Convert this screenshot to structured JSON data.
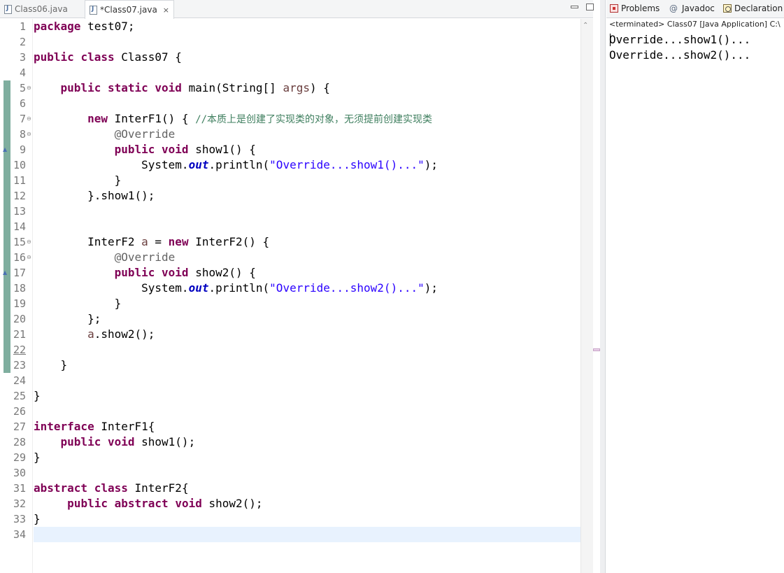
{
  "editor": {
    "tabs": [
      {
        "label": "Class06.java",
        "active": false
      },
      {
        "label": "*Class07.java",
        "active": true,
        "close": "×"
      }
    ],
    "line_numbers": [
      "1",
      "2",
      "3",
      "4",
      "5",
      "6",
      "7",
      "8",
      "9",
      "10",
      "11",
      "12",
      "13",
      "14",
      "15",
      "16",
      "17",
      "18",
      "19",
      "20",
      "21",
      "22",
      "23",
      "24",
      "25",
      "26",
      "27",
      "28",
      "29",
      "30",
      "31",
      "32",
      "33",
      "34"
    ],
    "current_line": "22",
    "fold_markers": [
      "⊖",
      "⊖",
      "⊖",
      "⊖",
      "⊖"
    ],
    "code": {
      "l1": {
        "kw": "package",
        "rest": " test07;"
      },
      "l3": {
        "kw1": "public",
        "kw2": "class",
        "rest": " Class07 {"
      },
      "l5": {
        "indent": "    ",
        "kw1": "public",
        "kw2": "static",
        "kw3": "void",
        "p1": " main(String[] ",
        "var": "args",
        "p2": ") {"
      },
      "l7": {
        "indent": "        ",
        "kw": "new",
        "p1": " InterF1() { ",
        "comment": "//本质上是创建了实现类的对象，无须提前创建实现类"
      },
      "l8": {
        "indent": "            ",
        "ann": "@Override"
      },
      "l9": {
        "indent": "            ",
        "kw1": "public",
        "kw2": "void",
        "rest": " show1() {"
      },
      "l10": {
        "indent": "                ",
        "p1": "System.",
        "fld": "out",
        "p2": ".println(",
        "str": "\"Override...show1()...\"",
        "p3": ");"
      },
      "l11": {
        "text": "            }"
      },
      "l12": {
        "text": "        }.show1();"
      },
      "l15": {
        "indent": "        ",
        "p1": "InterF2 ",
        "var": "a",
        "p2": " = ",
        "kw": "new",
        "p3": " InterF2() {"
      },
      "l16": {
        "indent": "            ",
        "ann": "@Override"
      },
      "l17": {
        "indent": "            ",
        "kw1": "public",
        "kw2": "void",
        "rest": " show2() {"
      },
      "l18": {
        "indent": "                ",
        "p1": "System.",
        "fld": "out",
        "p2": ".println(",
        "str": "\"Override...show2()...\"",
        "p3": ");"
      },
      "l19": {
        "text": "            }"
      },
      "l20": {
        "text": "        };"
      },
      "l21": {
        "indent": "        ",
        "var": "a",
        "rest": ".show2();"
      },
      "l23": {
        "text": "    }"
      },
      "l25": {
        "text": "}"
      },
      "l27": {
        "kw": "interface",
        "rest": " InterF1{"
      },
      "l28": {
        "indent": "    ",
        "kw1": "public",
        "kw2": "void",
        "rest": " show1();"
      },
      "l29": {
        "text": "}"
      },
      "l31": {
        "kw1": "abstract",
        "kw2": "class",
        "rest": " InterF2{"
      },
      "l32": {
        "indent": "     ",
        "kw1": "public",
        "kw2": "abstract",
        "kw3": "void",
        "rest": " show2();"
      },
      "l33": {
        "text": "}"
      }
    },
    "colors": {
      "keyword": "#7f0055",
      "string": "#2a00ff",
      "comment": "#3f7f5f",
      "annotation": "#646464",
      "static_field": "#0000c0",
      "current_line": "#e8f2fe"
    }
  },
  "views": {
    "tabs": [
      {
        "icon": "problems-icon",
        "label": "Problems"
      },
      {
        "icon": "javadoc-icon",
        "label": "Javadoc",
        "glyph": "@"
      },
      {
        "icon": "declaration-icon",
        "label": "Declaration"
      }
    ],
    "console": {
      "status": "<terminated> Class07 [Java Application] C:\\",
      "output": [
        "Override...show1()...",
        "Override...show2()..."
      ]
    }
  }
}
